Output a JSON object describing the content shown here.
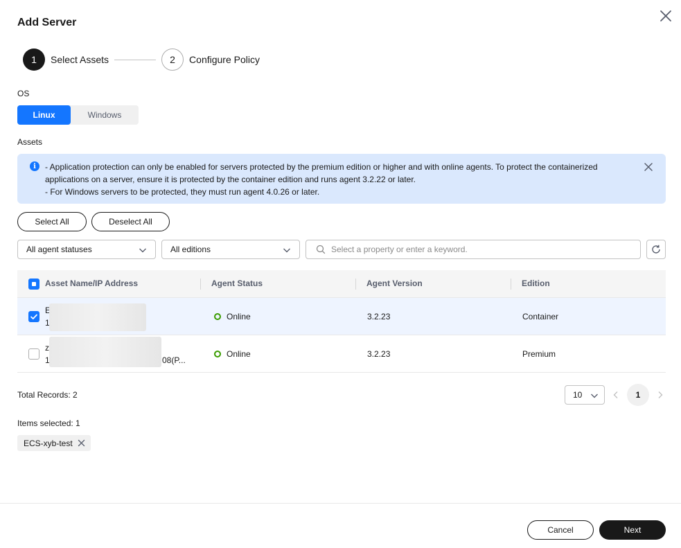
{
  "dialog": {
    "title": "Add Server"
  },
  "steps": [
    {
      "number": "1",
      "label": "Select Assets",
      "state": "active"
    },
    {
      "number": "2",
      "label": "Configure Policy",
      "state": "inactive"
    }
  ],
  "os": {
    "label": "OS",
    "options": [
      "Linux",
      "Windows"
    ],
    "selected": "Linux"
  },
  "assets": {
    "label": "Assets",
    "alert_lines": [
      "- Application protection can only be enabled for servers protected by the premium edition or higher and with online agents. To protect the containerized applications on a server, ensure it is protected by the container edition and runs agent 3.2.22 or later.",
      "- For Windows servers to be protected, they must run agent 4.0.26 or later."
    ],
    "select_all_label": "Select All",
    "deselect_all_label": "Deselect All"
  },
  "filters": {
    "agent_status": "All agent statuses",
    "edition": "All editions",
    "search_placeholder": "Select a property or enter a keyword."
  },
  "table": {
    "columns": [
      "Asset Name/IP Address",
      "Agent Status",
      "Agent Version",
      "Edition"
    ],
    "rows": [
      {
        "name_prefix": "E",
        "ip_prefix": "1",
        "ip_suffix": "",
        "agent_status": "Online",
        "agent_version": "3.2.23",
        "edition": "Container",
        "checked": true
      },
      {
        "name_prefix": "z",
        "ip_prefix": "1",
        "ip_suffix": "08(P...",
        "agent_status": "Online",
        "agent_version": "3.2.23",
        "edition": "Premium",
        "checked": false
      }
    ]
  },
  "pagination": {
    "total_records": "Total Records: 2",
    "page_size": "10",
    "current_page": "1"
  },
  "selection": {
    "items_selected": "Items selected: 1",
    "tags": [
      "ECS-xyb-test"
    ]
  },
  "footer": {
    "cancel_label": "Cancel",
    "next_label": "Next"
  },
  "colors": {
    "primary": "#1476ff",
    "dark": "#191919",
    "online": "#3a9c00",
    "alert_bg": "#dae8fd"
  }
}
